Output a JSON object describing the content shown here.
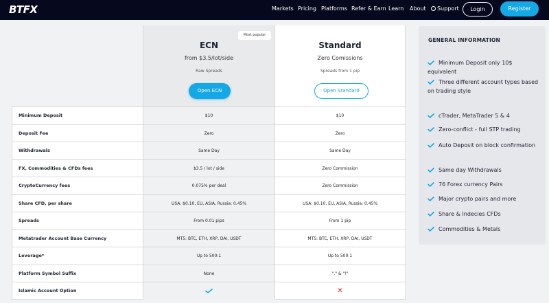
{
  "nav": {
    "logo": "BTFX",
    "links": [
      "Markets",
      "Pricing",
      "Platforms",
      "Refer & Earn",
      "Learn",
      "About",
      "Support"
    ],
    "login": "Login",
    "register": "Register"
  },
  "plans": {
    "ecn": {
      "badge": "Most popular",
      "name": "ECN",
      "price": "from $3.5/lot/side",
      "sub": "Raw Spreads",
      "button": "Open ECN"
    },
    "standard": {
      "name": "Standard",
      "price": "Zero Comissions",
      "sub": "Spreads from 1 pip",
      "button": "Open Standard"
    }
  },
  "rows": [
    {
      "label": "Minimum Deposit",
      "ecn": "$10",
      "std": "$10"
    },
    {
      "label": "Deposit Fee",
      "ecn": "Zero",
      "std": "Zero"
    },
    {
      "label": "Withdrawals",
      "ecn": "Same Day",
      "std": "Same Day"
    },
    {
      "label": "FX, Commodities & CFDs fees",
      "ecn": "$3.5 / lot / side",
      "std": "Zero Commission"
    },
    {
      "label": "CryptoCurrency fees",
      "ecn": "0.075% per deal",
      "std": "Zero Commission"
    },
    {
      "label": "Share CFD, per share",
      "ecn": "USA: $0.10, EU, ASIA, Russia: 0.45%",
      "std": "USA: $0.10, EU, ASIA, Russia: 0.45%"
    },
    {
      "label": "Spreads",
      "ecn": "From 0.01 pips",
      "std": "From 1 pip"
    },
    {
      "label": "Metatrader Account Base Currency",
      "ecn": "MT5: BTC, ETH, XRP, DAI, USDT",
      "std": "MT5: BTC, ETH, XRP, DAI, USDT"
    },
    {
      "label": "Leverage*",
      "ecn": "Up to 500:1",
      "std": "Up to 500:1"
    },
    {
      "label": "Platform Symbol Suffix",
      "ecn": "None",
      "std": "\".\" & \"!\""
    },
    {
      "label": "Islamic Account Option",
      "ecn": "",
      "std": ""
    }
  ],
  "islamic": {
    "ecn_icon": "check-icon",
    "std_icon": "cross-icon"
  },
  "info": {
    "title": "GENERAL INFORMATION",
    "items": [
      "Minimum Deposit only 10$ equivalent",
      "Three different account types based on trading style",
      "cTrader, MetaTrader 5 & 4",
      "Zero-conflict - full STP trading",
      "Auto Deposit on block confirmation",
      "Same day Withdrawals",
      "76 Forex currency Pairs",
      "Major crypto pairs and more",
      "Share & Indecies CFDs",
      "Commodities & Metals"
    ]
  },
  "colors": {
    "accent": "#14a8e6",
    "nav_bg": "#06081d",
    "cross": "#e0242c"
  }
}
